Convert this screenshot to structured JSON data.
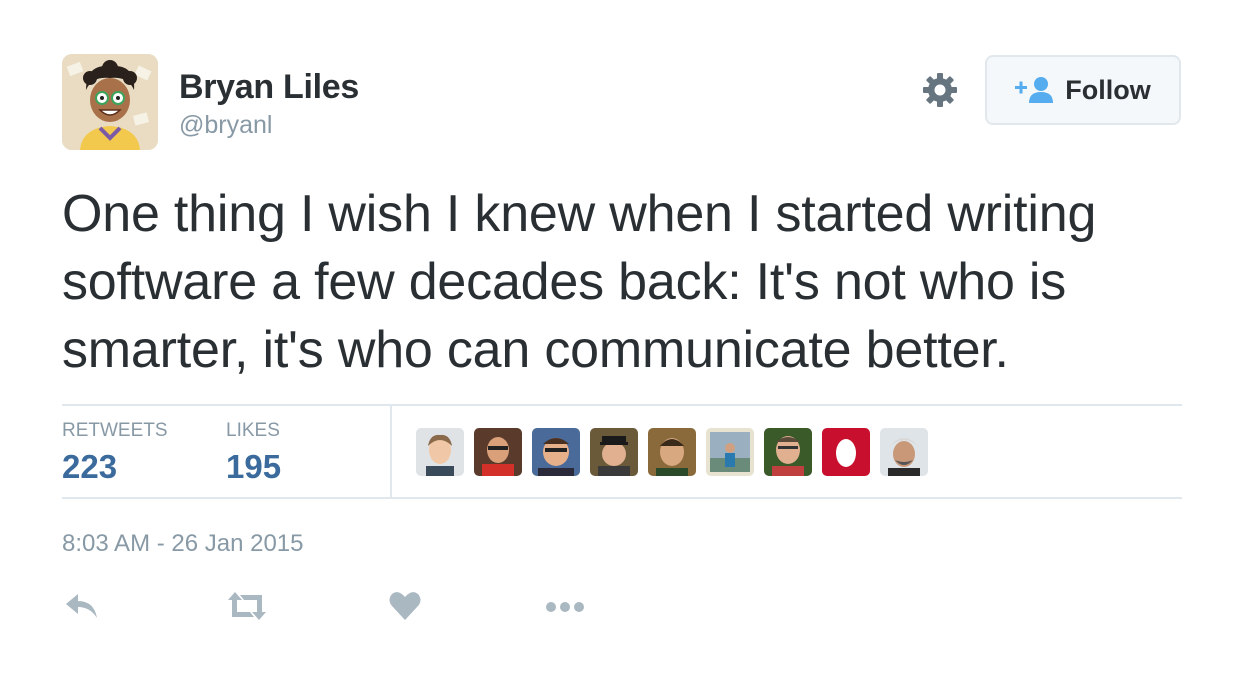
{
  "author": {
    "name": "Bryan Liles",
    "handle": "@bryanl"
  },
  "follow_button": {
    "label": "Follow"
  },
  "tweet": {
    "text": "One thing I wish I knew when I started writing software a few decades back: It's not who is smarter, it's who can communicate better."
  },
  "stats": {
    "retweets_label": "RETWEETS",
    "retweets_value": "223",
    "likes_label": "LIKES",
    "likes_value": "195"
  },
  "likers": [
    "avatar-1",
    "avatar-2",
    "avatar-3",
    "avatar-4",
    "avatar-5",
    "avatar-6",
    "avatar-7",
    "avatar-8",
    "avatar-9"
  ],
  "timestamp": "8:03 AM - 26 Jan 2015",
  "icons": {
    "settings": "gear-icon",
    "follow": "add-user-icon",
    "reply": "reply-icon",
    "retweet": "retweet-icon",
    "like": "heart-icon",
    "more": "more-dots-icon"
  },
  "colors": {
    "text": "#292f33",
    "muted": "#8899a6",
    "accent": "#3b6a9c",
    "follow_icon": "#55acee",
    "divider": "#e1e8ed"
  }
}
